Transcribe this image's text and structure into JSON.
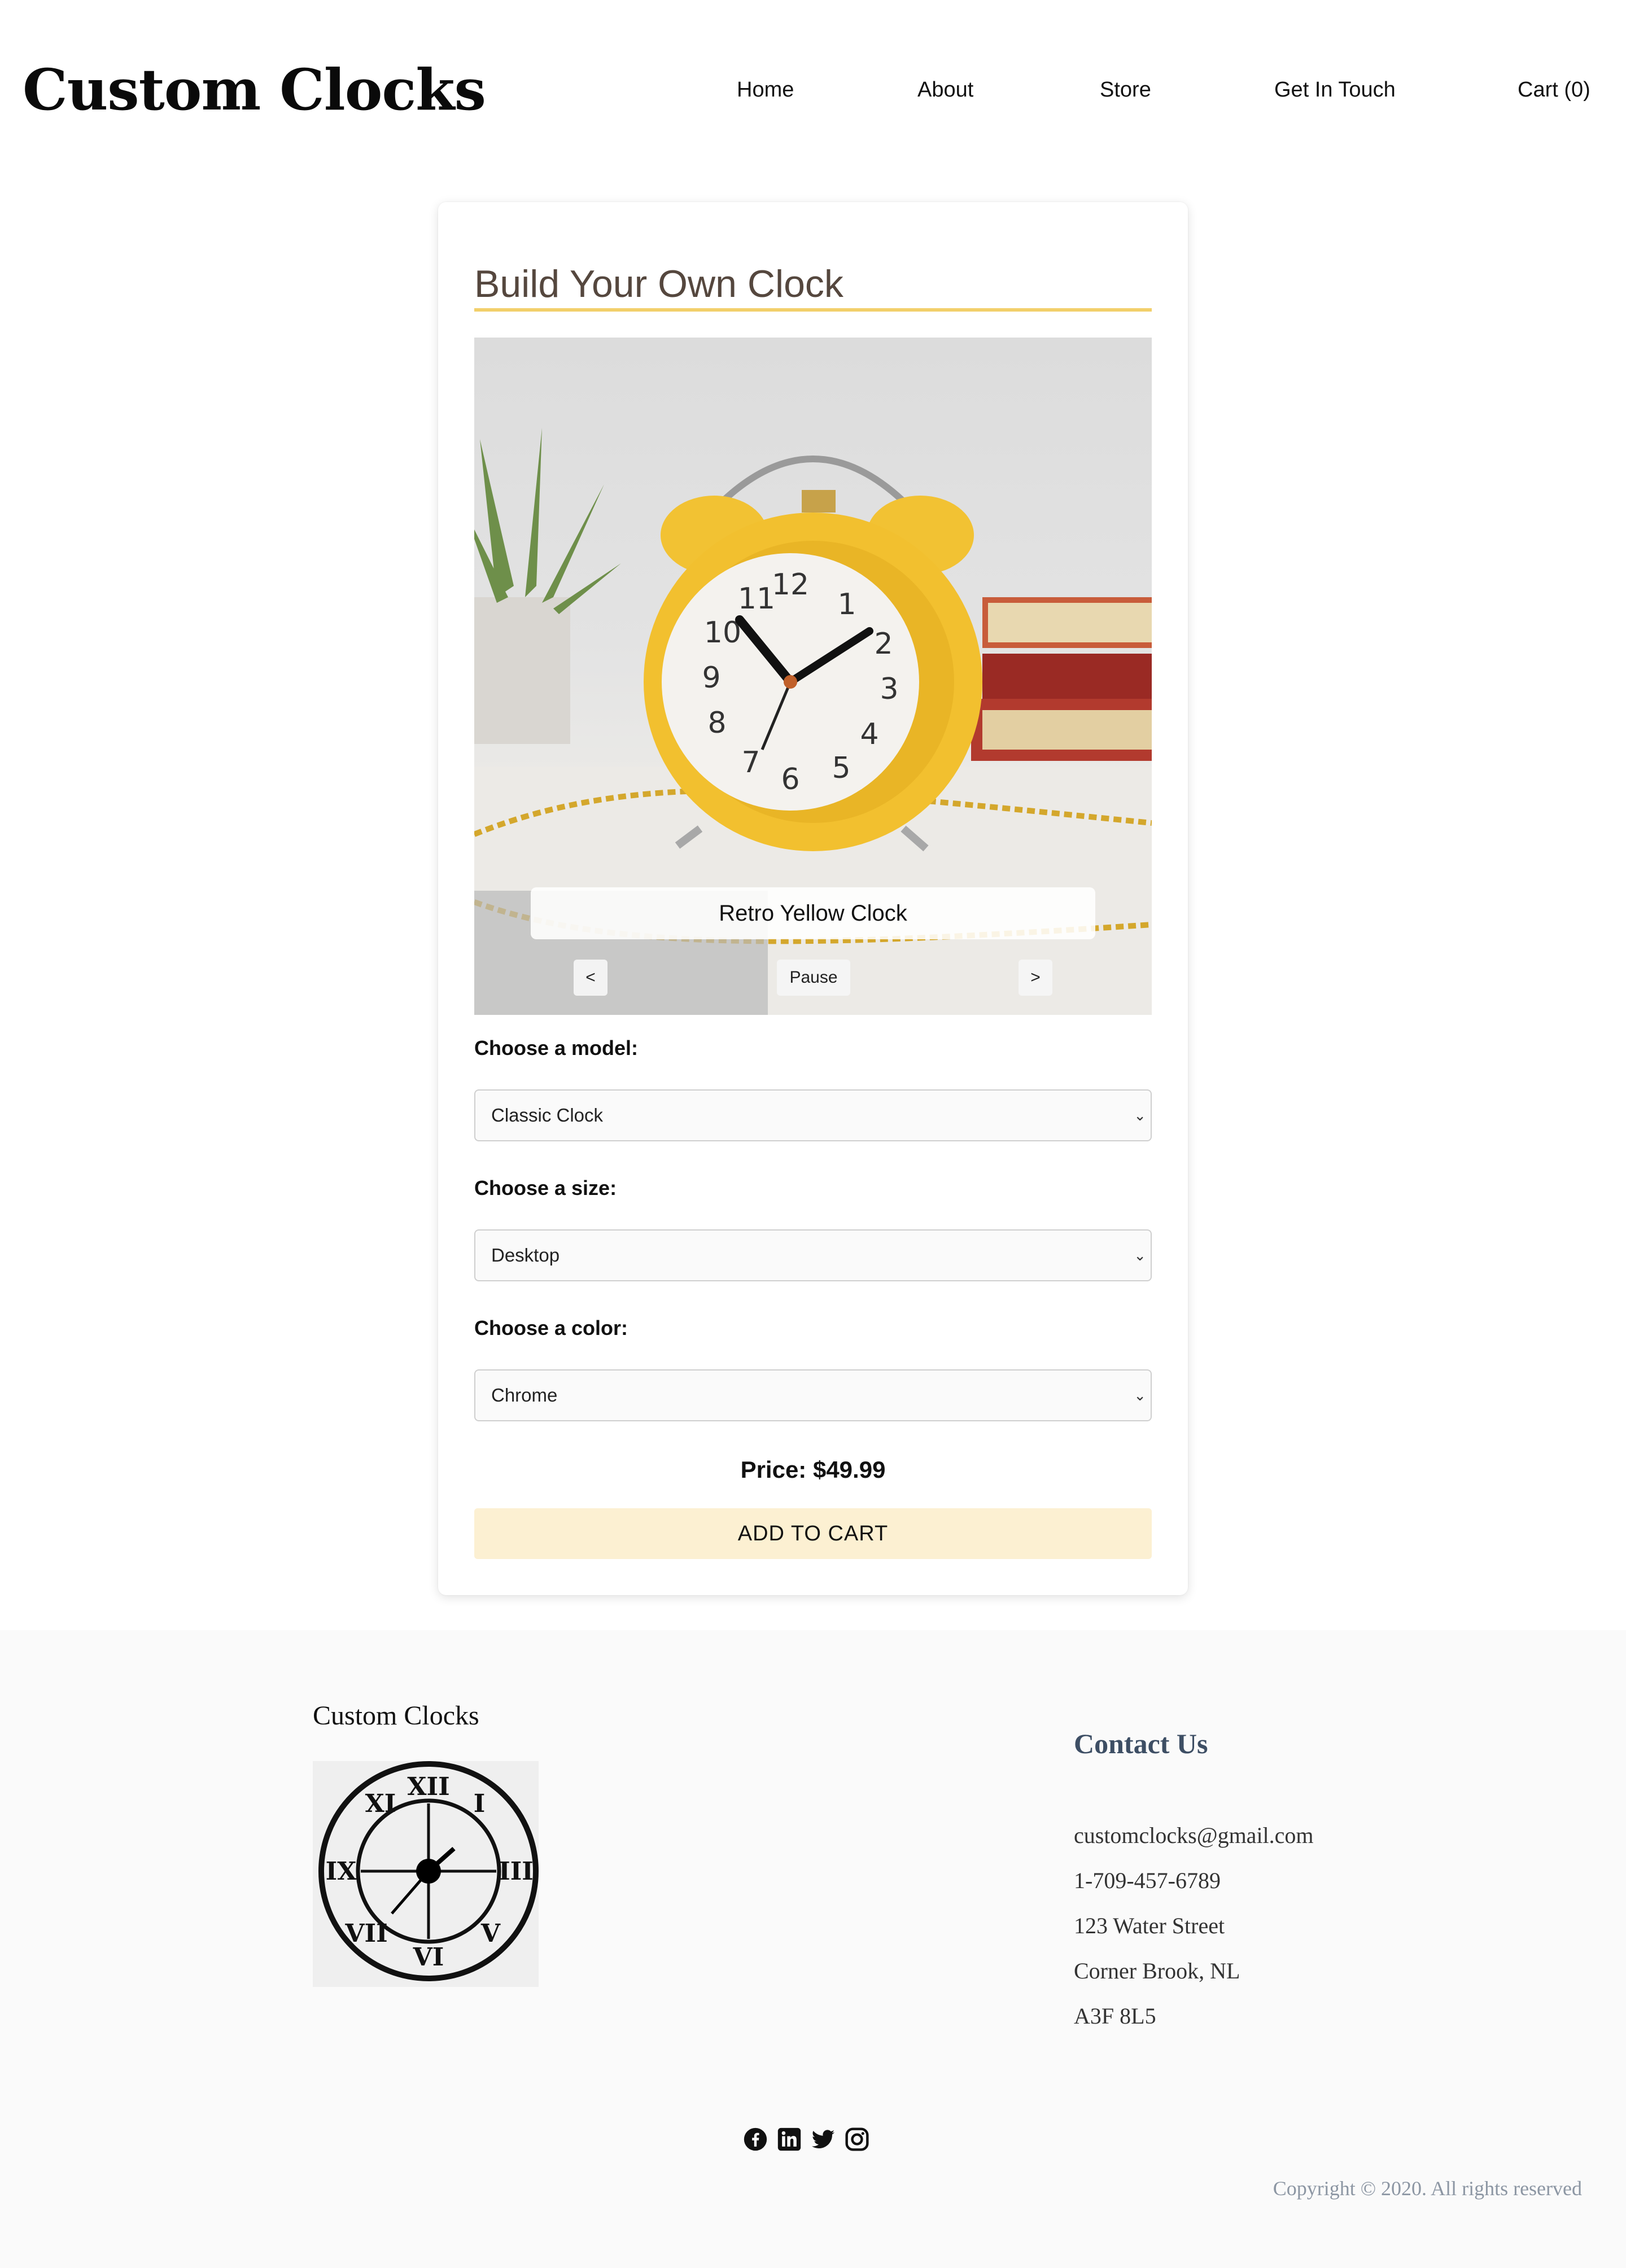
{
  "header": {
    "brand": "Custom Clocks",
    "nav": {
      "home": "Home",
      "about": "About",
      "store": "Store",
      "contact": "Get In Touch",
      "cart": "Cart (0)"
    }
  },
  "builder": {
    "title": "Build Your Own Clock",
    "slideshow": {
      "caption": "Retro Yellow Clock",
      "prev_label": "<",
      "pause_label": "Pause",
      "next_label": ">"
    },
    "model": {
      "label": "Choose a model:",
      "value": "Classic Clock"
    },
    "size": {
      "label": "Choose a size:",
      "value": "Desktop"
    },
    "color": {
      "label": "Choose a color:",
      "value": "Chrome"
    },
    "price": "Price: $49.99",
    "add_to_cart": "ADD TO CART"
  },
  "footer": {
    "brand": "Custom Clocks",
    "contact_title": "Contact Us",
    "email": "customclocks@gmail.com",
    "phone": "1-709-457-6789",
    "street": "123 Water Street",
    "city": "Corner Brook, NL",
    "postal": "A3F 8L5",
    "socials": [
      "facebook-icon",
      "linkedin-icon",
      "twitter-icon",
      "instagram-icon"
    ],
    "copyright": "Copyright © 2020. All rights reserved"
  },
  "colors": {
    "title_text": "#55473e",
    "title_rule": "#f2cf6a",
    "add_button_bg": "#fcf0d2",
    "contact_title": "#3d4e64",
    "footer_bg": "#fafafa"
  }
}
